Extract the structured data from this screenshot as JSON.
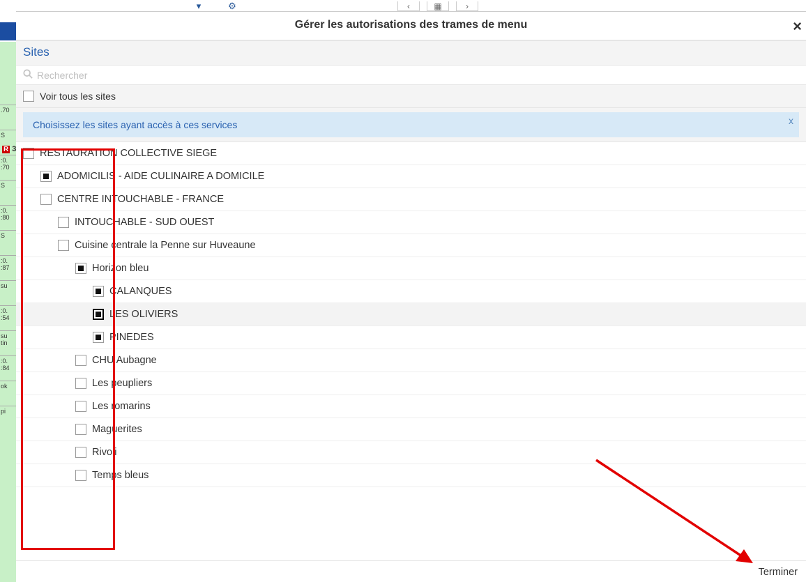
{
  "modal": {
    "title": "Gérer les autorisations des trames de menu",
    "close_label": "×",
    "section_title": "Sites",
    "search_placeholder": "Rechercher",
    "show_all_label": "Voir tous les sites",
    "banner_text": "Choisissez les sites ayant accès à ces services",
    "banner_close": "x",
    "footer_button": "Terminer"
  },
  "tree": [
    {
      "level": 0,
      "state": "empty",
      "label": "RESTAURATION COLLECTIVE SIEGE"
    },
    {
      "level": 1,
      "state": "partial",
      "label": "ADOMICILIS - AIDE CULINAIRE A DOMICILE"
    },
    {
      "level": 1,
      "state": "empty",
      "label": "CENTRE INTOUCHABLE - FRANCE"
    },
    {
      "level": 2,
      "state": "empty",
      "label": "INTOUCHABLE - SUD OUEST"
    },
    {
      "level": 2,
      "state": "empty",
      "label": "Cuisine centrale la Penne sur Huveaune"
    },
    {
      "level": 3,
      "state": "partial",
      "label": "Horizon bleu"
    },
    {
      "level": 4,
      "state": "partial",
      "label": "CALANQUES"
    },
    {
      "level": 4,
      "state": "partial",
      "label": "LES OLIVIERS",
      "selected": true
    },
    {
      "level": 4,
      "state": "partial",
      "label": "PINEDES"
    },
    {
      "level": 3,
      "state": "empty",
      "label": "CHU Aubagne"
    },
    {
      "level": 3,
      "state": "empty",
      "label": "Les peupliers"
    },
    {
      "level": 3,
      "state": "empty",
      "label": "Les romarins"
    },
    {
      "level": 3,
      "state": "empty",
      "label": "Maguerites"
    },
    {
      "level": 3,
      "state": "empty",
      "label": "Rivoli"
    },
    {
      "level": 3,
      "state": "empty",
      "label": "Temps bleus"
    }
  ],
  "bg": {
    "date_badge_prefix": "R",
    "date_badge_value": "3",
    "side_cells": [
      ".70",
      "S",
      ":0.\n:70",
      "S",
      ":0.\n:80",
      "S",
      ":0.\n:87",
      "su",
      ":0.\n:54",
      "su\ntin",
      ":0.\n:84",
      "ok",
      "pi"
    ]
  }
}
